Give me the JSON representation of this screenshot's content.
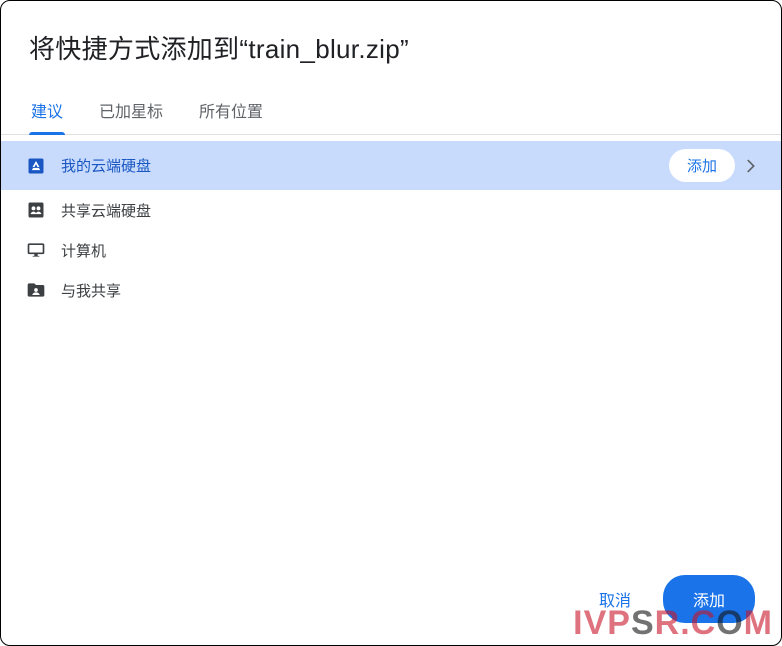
{
  "dialog": {
    "title": "将快捷方式添加到“train_blur.zip”"
  },
  "tabs": {
    "items": [
      "建议",
      "已加星标",
      "所有位置"
    ],
    "active": 0
  },
  "locations": {
    "items": [
      {
        "icon": "drive",
        "label": "我的云端硬盘",
        "selected": true,
        "pill": "添加",
        "hasChildren": true
      },
      {
        "icon": "shared-drive",
        "label": "共享云端硬盘",
        "selected": false
      },
      {
        "icon": "computer",
        "label": "计算机",
        "selected": false
      },
      {
        "icon": "shared-with-me",
        "label": "与我共享",
        "selected": false
      }
    ]
  },
  "footer": {
    "cancel": "取消",
    "confirm": "添加"
  },
  "watermark": {
    "seg1": "IVP",
    "seg2": "S",
    "seg3": "R.C",
    "seg4": "O",
    "seg5": "M"
  }
}
